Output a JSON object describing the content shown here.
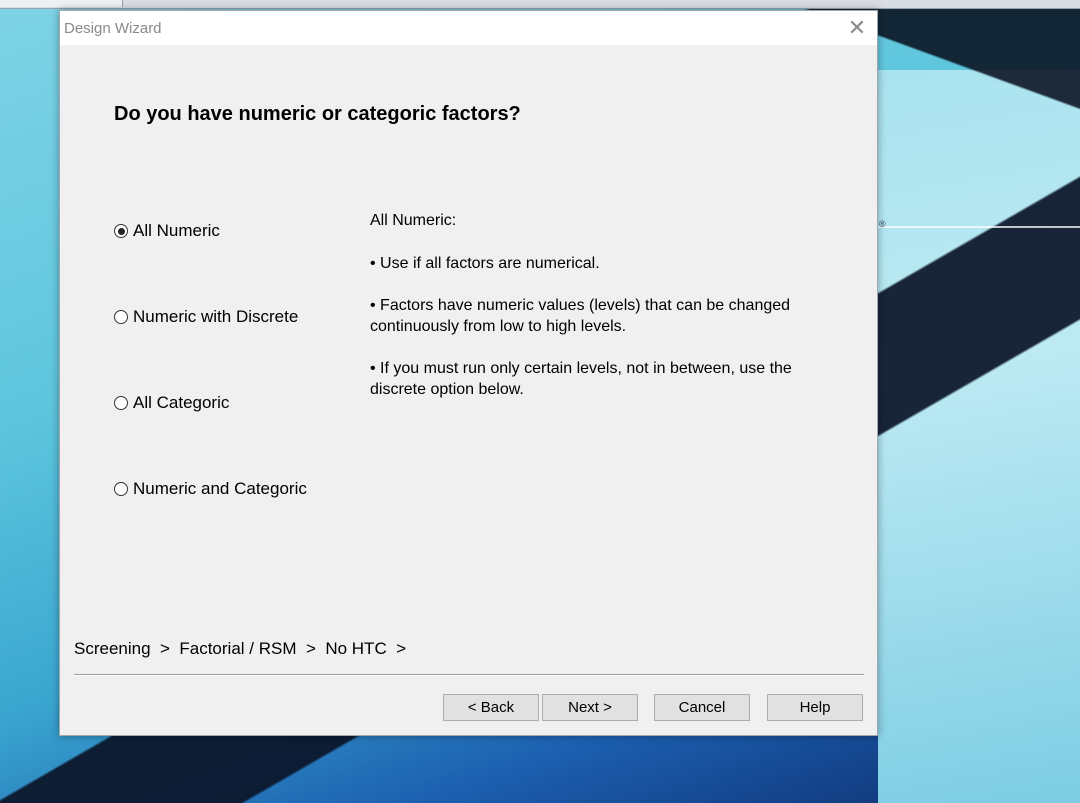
{
  "window": {
    "title": "Design Wizard"
  },
  "heading": "Do you have numeric or categoric factors?",
  "options": [
    {
      "label": "All Numeric",
      "selected": true
    },
    {
      "label": "Numeric with Discrete",
      "selected": false
    },
    {
      "label": "All Categoric",
      "selected": false
    },
    {
      "label": "Numeric and Categoric",
      "selected": false
    }
  ],
  "description": {
    "title": "All Numeric:",
    "bullets": [
      "• Use if all factors are numerical.",
      "• Factors have numeric values (levels) that can be changed continuously from low to high levels.",
      "• If you must run only certain levels, not in between, use the discrete option below."
    ]
  },
  "breadcrumb": "Screening  >  Factorial / RSM  >  No HTC  >",
  "buttons": {
    "back": "< Back",
    "next": "Next >",
    "cancel": "Cancel",
    "help": "Help"
  },
  "icons": {
    "close": "close-icon"
  }
}
